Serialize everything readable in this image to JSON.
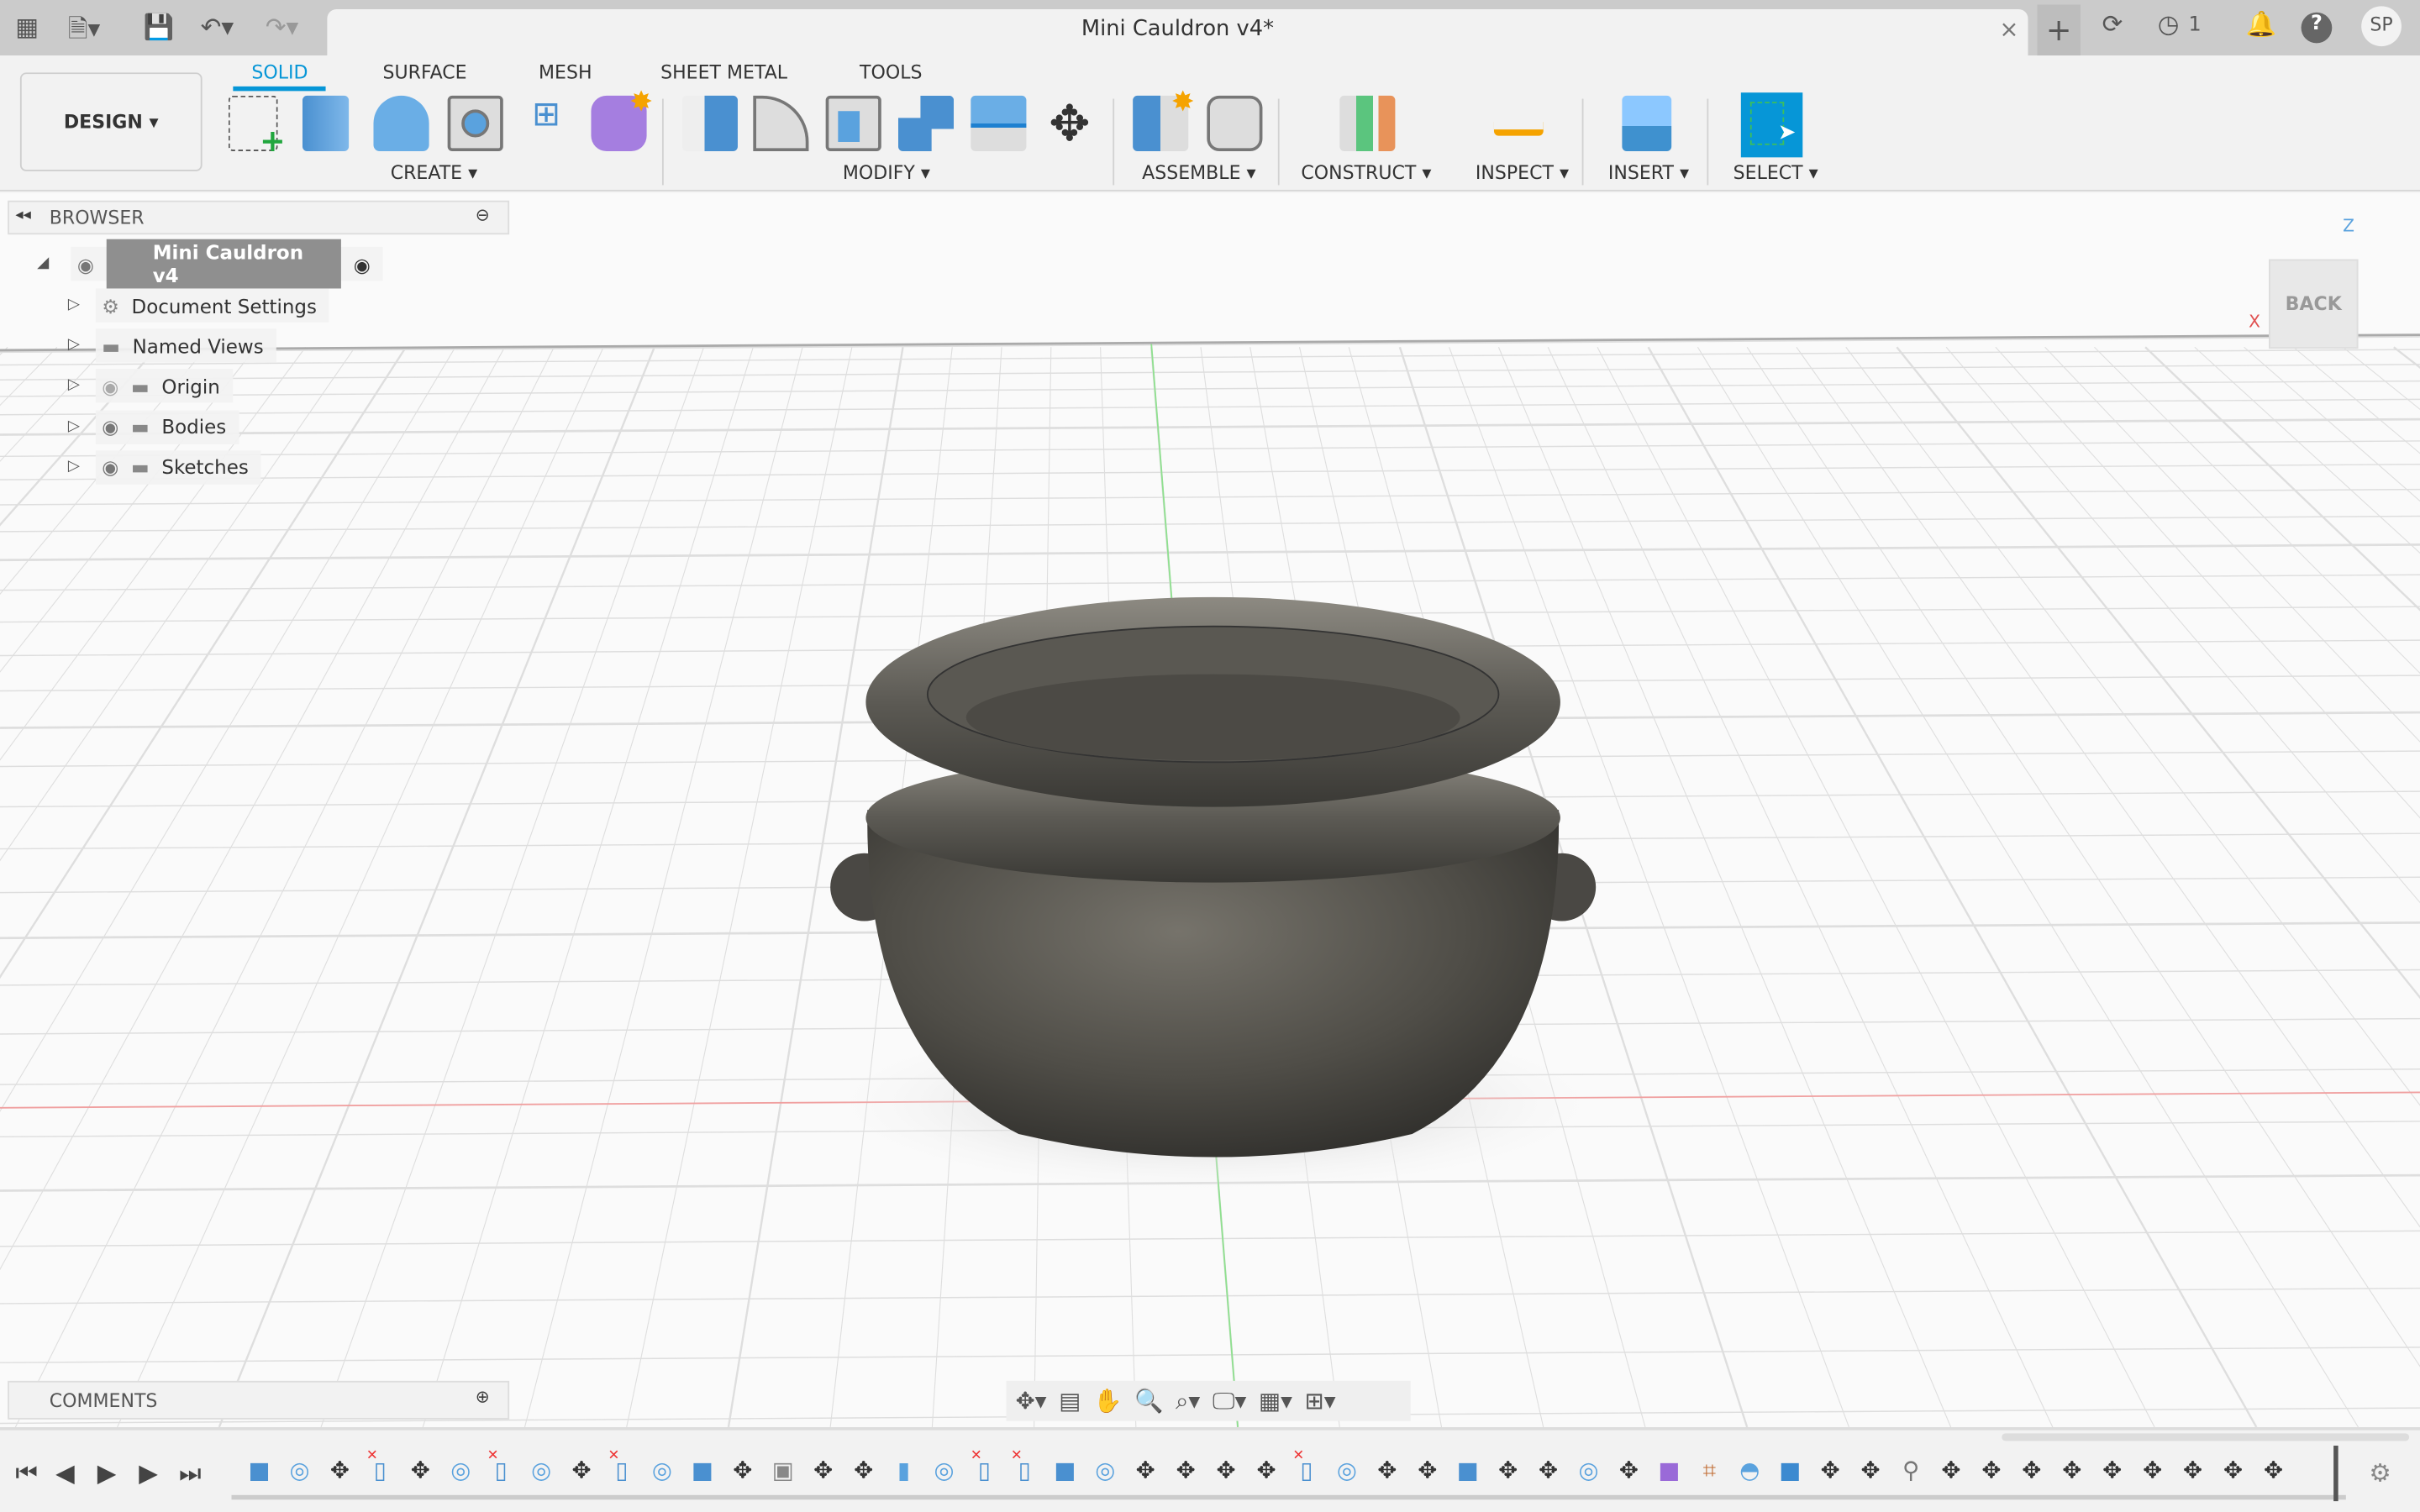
{
  "window": {
    "title": "Mini Cauldron v4*",
    "close": "×",
    "user_initials": "SP",
    "jobs_count": "1"
  },
  "quick_access": {
    "apps": "▦",
    "file": "🗎▾",
    "save": "💾",
    "undo": "↶▾",
    "redo": "↷▾"
  },
  "workspace": {
    "label": "DESIGN ▾"
  },
  "tabs": [
    {
      "label": "SOLID",
      "active": true
    },
    {
      "label": "SURFACE"
    },
    {
      "label": "MESH"
    },
    {
      "label": "SHEET METAL"
    },
    {
      "label": "TOOLS"
    }
  ],
  "groups": [
    {
      "label": "CREATE ▾"
    },
    {
      "label": "MODIFY ▾"
    },
    {
      "label": "ASSEMBLE ▾"
    },
    {
      "label": "CONSTRUCT ▾"
    },
    {
      "label": "INSPECT ▾"
    },
    {
      "label": "INSERT ▾"
    },
    {
      "label": "SELECT ▾"
    }
  ],
  "browser": {
    "title": "BROWSER",
    "root": "Mini Cauldron v4",
    "items": [
      {
        "label": "Document Settings",
        "icon": "gear"
      },
      {
        "label": "Named Views",
        "icon": "folder"
      },
      {
        "label": "Origin",
        "icon": "folder",
        "hidden": true
      },
      {
        "label": "Bodies",
        "icon": "folder"
      },
      {
        "label": "Sketches",
        "icon": "folder"
      }
    ]
  },
  "comments": {
    "title": "COMMENTS"
  },
  "viewcube": {
    "face": "BACK",
    "z": "Z",
    "x": "X"
  },
  "timeline": {
    "items": [
      "extrude",
      "fillet",
      "move",
      "delete",
      "move",
      "fillet",
      "delete",
      "fillet",
      "move",
      "delete",
      "fillet",
      "extrude",
      "move",
      "shell",
      "move",
      "move",
      "cylinder",
      "fillet",
      "delete",
      "delete",
      "extrude",
      "fillet",
      "move",
      "move",
      "move",
      "move",
      "delete",
      "fillet",
      "move",
      "move",
      "extrude",
      "move",
      "move",
      "fillet",
      "move",
      "form",
      "sketch",
      "revolve",
      "box",
      "move",
      "move",
      "joint",
      "move",
      "move",
      "move",
      "move",
      "move",
      "move",
      "move",
      "move",
      "move"
    ]
  },
  "colors": {
    "accent": "#0696d7",
    "body": "#55534d"
  }
}
